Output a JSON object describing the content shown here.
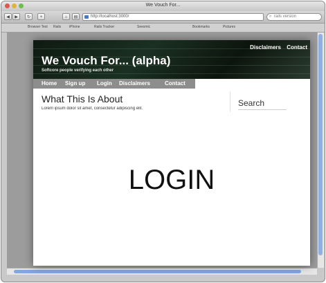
{
  "browser": {
    "window_title": "We Vouch For...",
    "url": "http://localhost:3000/",
    "search_placeholder": "rails version",
    "bookmarks": [
      "Browser Test",
      "Rails",
      "iPhone",
      "Rails Tracker",
      "Seesmic",
      "Bookmarks",
      "Pictures"
    ]
  },
  "site": {
    "top_links": [
      "Disclaimers",
      "Contact"
    ],
    "title": "We Vouch For... (alpha)",
    "tagline": "Softcore people verifying each other",
    "nav": [
      "Home",
      "Sign up",
      "Login",
      "Disclaimers",
      "Contact"
    ]
  },
  "content": {
    "heading": "What This Is About",
    "body": "Lorem ipsum dolor sit amet, consectetur adipiscing elit."
  },
  "sidebar": {
    "heading": "Search"
  },
  "overlay": {
    "label": "LOGIN"
  }
}
